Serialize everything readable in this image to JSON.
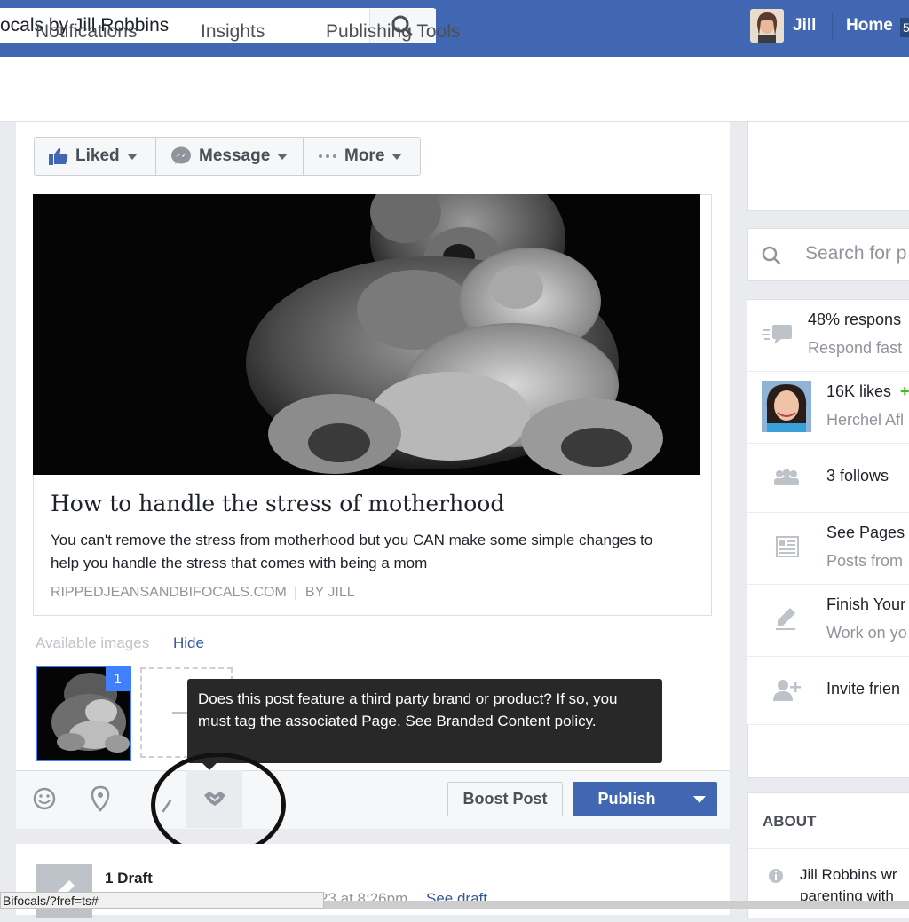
{
  "topbar": {
    "search_value": "ocals by Jill Robbins",
    "user_name": "Jill",
    "home_label": "Home",
    "home_badge": "5"
  },
  "page_nav": {
    "tabs": [
      "Notifications",
      "Insights",
      "Publishing Tools"
    ]
  },
  "actions": {
    "liked_label": "Liked",
    "message_label": "Message",
    "more_label": "More"
  },
  "composer": {
    "link_title": "How to handle the stress of motherhood",
    "link_description": "You can't remove the stress from motherhood but you CAN make some simple changes to help you handle the stress that comes with being a mom",
    "link_domain": "RIPPEDJEANSANDBIFOCALS.COM",
    "link_separator": "|",
    "link_author": "BY JILL",
    "available_images_label": "Available images",
    "hide_label": "Hide",
    "thumb_number": "1",
    "tooltip_text": "Does this post feature a third party brand or product? If so, you must tag the associated Page. See Branded Content policy.",
    "boost_label": "Boost Post",
    "publish_label": "Publish"
  },
  "right_column": {
    "search_placeholder": "Search for p",
    "response_rate": "48% respons",
    "response_sub": "Respond fast",
    "likes_count": "16K likes",
    "likes_plus": "+",
    "likes_sub": "Herchel Afl",
    "follows": "3 follows",
    "see_pages": "See Pages",
    "see_pages_sub": "Posts from",
    "finish_your": "Finish Your",
    "finish_sub": "Work on yo",
    "invite": "Invite frien",
    "about_heading": "ABOUT",
    "about_line1": "Jill Robbins wr",
    "about_line2": "parenting with"
  },
  "drafts": {
    "title": "1 Draft",
    "time": "23 at 8:26pm",
    "see_draft": "See draft"
  },
  "statusbar_url": "Bifocals/?fref=ts#",
  "colors": {
    "facebook_blue": "#4267b2",
    "accent_blue": "#4080ff",
    "tooltip_bg": "#282828"
  }
}
